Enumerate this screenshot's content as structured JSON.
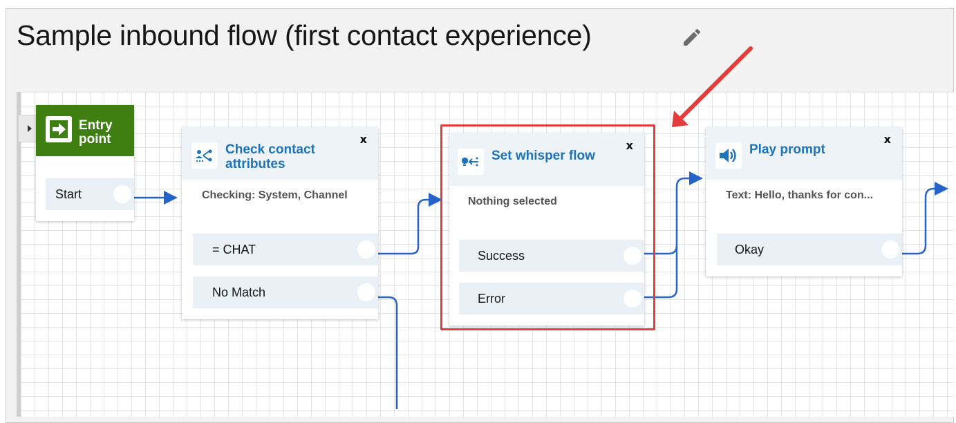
{
  "page": {
    "title": "Sample inbound flow (first contact experience)"
  },
  "blocks": {
    "entry": {
      "title_line1": "Entry",
      "title_line2": "point",
      "branch": "Start",
      "icon": "arrow-right-icon"
    },
    "check": {
      "title_line1": "Check contact",
      "title_line2": "attributes",
      "close": "x",
      "description": "Checking: System, Channel",
      "branches": [
        "= CHAT",
        "No Match"
      ],
      "icon": "branch-icon"
    },
    "whisper": {
      "title": "Set whisper flow",
      "close": "x",
      "description": "Nothing selected",
      "branches": [
        "Success",
        "Error"
      ],
      "icon": "whisper-icon"
    },
    "play": {
      "title": "Play prompt",
      "close": "x",
      "description": "Text: Hello, thanks for con...",
      "branches": [
        "Okay"
      ],
      "icon": "speaker-icon"
    }
  },
  "colors": {
    "link_blue": "#1f73b7",
    "wire_blue": "#2563c9",
    "entry_green": "#3f7f11",
    "highlight_red": "#e53b3b"
  }
}
